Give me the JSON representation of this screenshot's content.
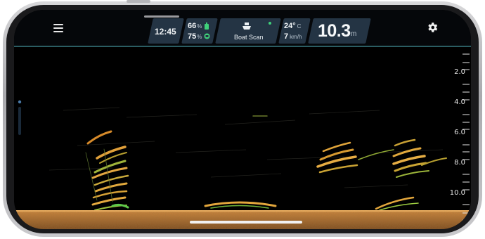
{
  "status": {
    "time": "12:45",
    "battery_1": {
      "value": "66",
      "unit": "%"
    },
    "battery_2": {
      "value": "75",
      "unit": "%"
    },
    "scan_mode": "Boat Scan",
    "temperature": {
      "value": "24°",
      "unit": "C"
    },
    "speed": {
      "value": "7",
      "unit": "km/h"
    },
    "depth": {
      "value": "10.3",
      "unit": "m"
    }
  },
  "depth_scale": {
    "labels": [
      "2.0",
      "4.0",
      "6.0",
      "8.0",
      "10.0"
    ]
  },
  "colors": {
    "panel": "#243444",
    "accent_line": "#2b5d63",
    "bottom": "#c8803a",
    "signal_green": "#3fd07a"
  },
  "icons": {
    "menu": "hamburger-menu-icon",
    "settings": "gear-icon",
    "boat": "boat-icon",
    "battery": "battery-icon",
    "connection": "status-dot-icon"
  }
}
